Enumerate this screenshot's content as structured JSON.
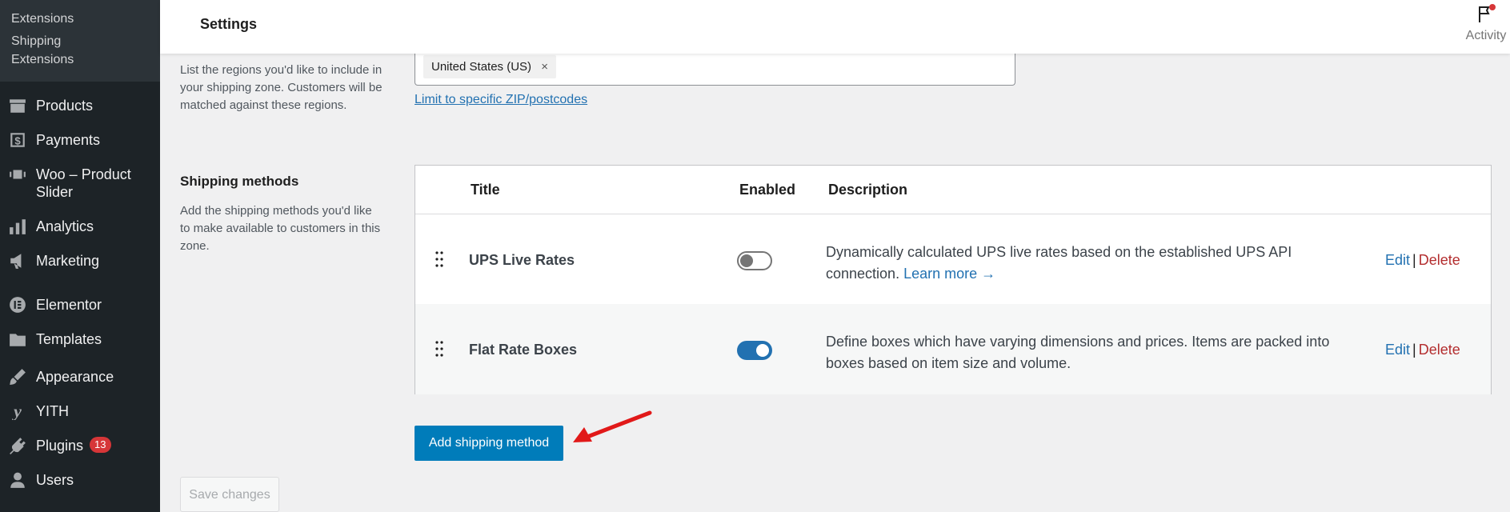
{
  "sidebar": {
    "submenu": [
      {
        "label": "Extensions"
      },
      {
        "label": "Shipping Extensions"
      }
    ],
    "items": [
      {
        "label": "Products",
        "icon": "archive-icon"
      },
      {
        "label": "Payments",
        "icon": "payments-icon"
      },
      {
        "label": "Woo – Product Slider",
        "icon": "slider-icon"
      },
      {
        "label": "Analytics",
        "icon": "bar-chart-icon"
      },
      {
        "label": "Marketing",
        "icon": "megaphone-icon"
      },
      {
        "label": "Elementor",
        "icon": "elementor-icon"
      },
      {
        "label": "Templates",
        "icon": "folder-icon"
      },
      {
        "label": "Appearance",
        "icon": "paintbrush-icon"
      },
      {
        "label": "YITH",
        "icon": "yith-icon"
      },
      {
        "label": "Plugins",
        "icon": "plug-icon",
        "badge": "13"
      },
      {
        "label": "Users",
        "icon": "user-icon"
      }
    ]
  },
  "header": {
    "title": "Settings",
    "activity_label": "Activity"
  },
  "zone_regions": {
    "description": "List the regions you'd like to include in your shipping zone. Customers will be matched against these regions.",
    "selected_region": "United States (US)",
    "remove_symbol": "×",
    "zip_link": "Limit to specific ZIP/postcodes"
  },
  "shipping_methods": {
    "section_title": "Shipping methods",
    "description": "Add the shipping methods you'd like to make available to customers in this zone.",
    "columns": {
      "title": "Title",
      "enabled": "Enabled",
      "description": "Description"
    },
    "rows": [
      {
        "title": "UPS Live Rates",
        "enabled": false,
        "description": "Dynamically calculated UPS live rates based on the established UPS API connection.",
        "learn_more": "Learn more →",
        "edit": "Edit",
        "separator": "|",
        "delete": "Delete"
      },
      {
        "title": "Flat Rate Boxes",
        "enabled": true,
        "description": "Define boxes which have varying dimensions and prices. Items are packed into boxes based on item size and volume.",
        "edit": "Edit",
        "separator": "|",
        "delete": "Delete"
      }
    ],
    "add_button": "Add shipping method"
  },
  "footer": {
    "save_button": "Save changes"
  },
  "colors": {
    "accent": "#007cba",
    "link": "#2271b1",
    "delete": "#b32d2e",
    "sidebar": "#1d2327",
    "annotation_arrow": "#e11919"
  }
}
